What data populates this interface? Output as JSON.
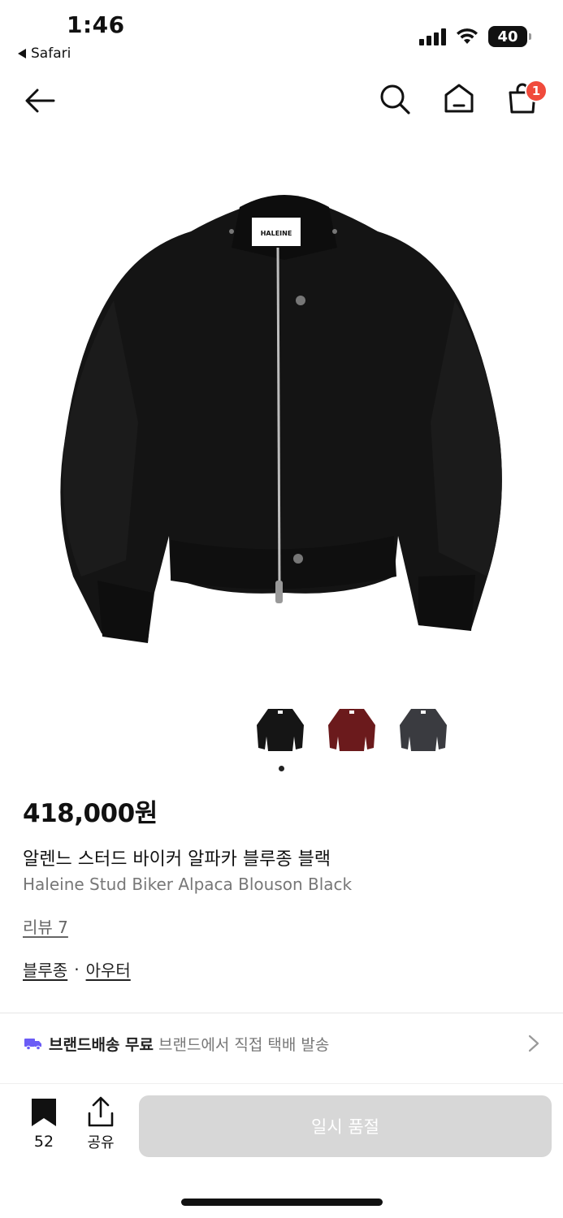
{
  "status_bar": {
    "time": "1:46",
    "back_app": "Safari",
    "battery": "40",
    "battery_level": 0.4
  },
  "nav": {
    "cart_count": "1"
  },
  "product": {
    "brand_label": "HALEINE",
    "price": "418,000원",
    "name_ko": "알렌느 스터드 바이커 알파카 블루종 블랙",
    "name_en": "Haleine Stud Biker Alpaca Blouson Black",
    "review": "리뷰 7",
    "category_1": "블루종",
    "category_sep": "·",
    "category_2": "아우터",
    "colors": [
      "#151515",
      "#6b1a1c",
      "#3a3b40"
    ]
  },
  "shipping": {
    "title": "브랜드배송 무료",
    "desc": "브랜드에서 직접 택배 발송",
    "icon_color": "#6b5cf6"
  },
  "bottom_bar": {
    "bookmark_count": "52",
    "share_label": "공유",
    "button_label": "일시 품절"
  }
}
